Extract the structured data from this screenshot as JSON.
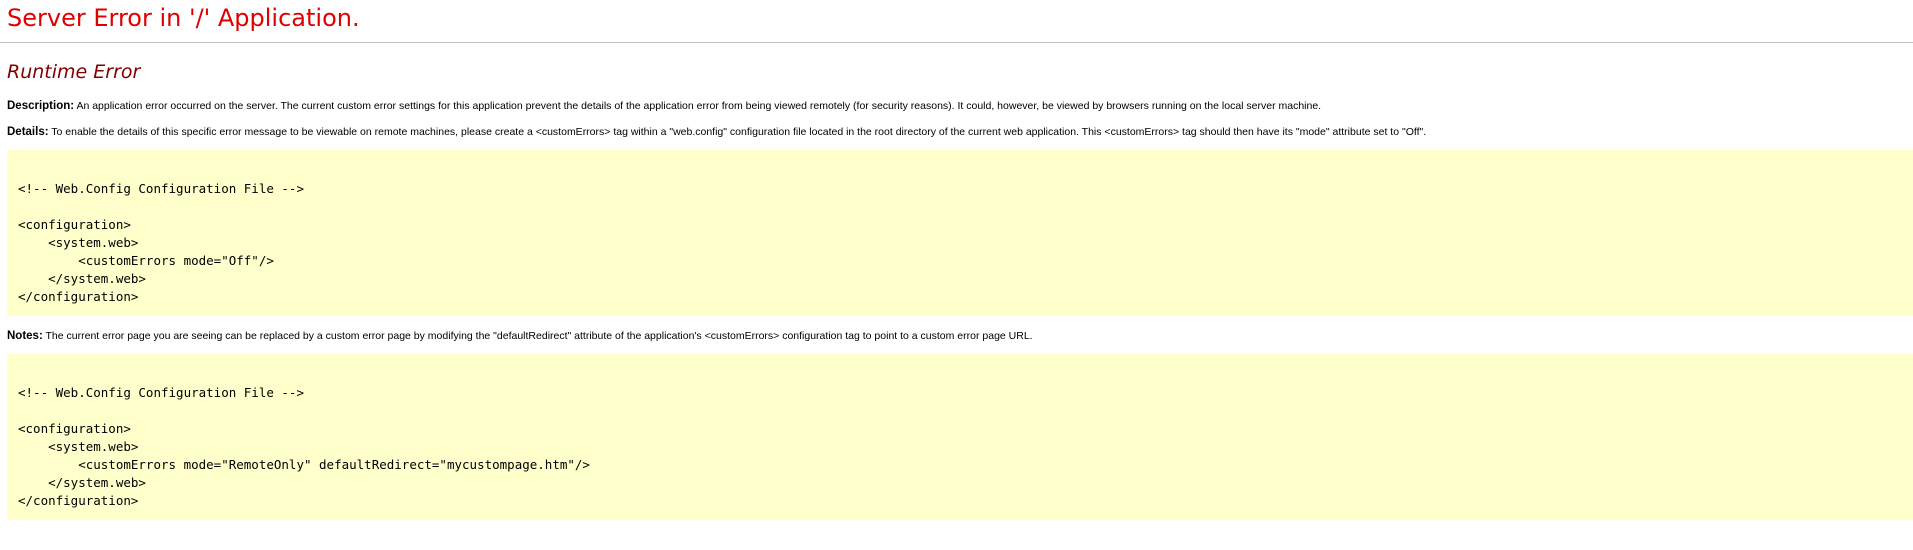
{
  "error": {
    "title": "Server Error in '/' Application.",
    "type": "Runtime Error",
    "description": {
      "label": "Description:",
      "text": "An application error occurred on the server. The current custom error settings for this application prevent the details of the application error from being viewed remotely (for security reasons). It could, however, be viewed by browsers running on the local server machine."
    },
    "details": {
      "label": "Details:",
      "text": "To enable the details of this specific error message to be viewable on remote machines, please create a <customErrors> tag within a \"web.config\" configuration file located in the root directory of the current web application. This <customErrors> tag should then have its \"mode\" attribute set to \"Off\"."
    },
    "config_sample_1": "\n<!-- Web.Config Configuration File -->\n\n<configuration>\n    <system.web>\n        <customErrors mode=\"Off\"/>\n    </system.web>\n</configuration>",
    "notes": {
      "label": "Notes:",
      "text": "The current error page you are seeing can be replaced by a custom error page by modifying the \"defaultRedirect\" attribute of the application's <customErrors> configuration tag to point to a custom error page URL."
    },
    "config_sample_2": "\n<!-- Web.Config Configuration File -->\n\n<configuration>\n    <system.web>\n        <customErrors mode=\"RemoteOnly\" defaultRedirect=\"mycustompage.htm\"/>\n    </system.web>\n</configuration>"
  },
  "colors": {
    "title": "#e00000",
    "subtitle": "#800000",
    "code_background": "#ffffcc",
    "rule": "#c0c0c0"
  }
}
